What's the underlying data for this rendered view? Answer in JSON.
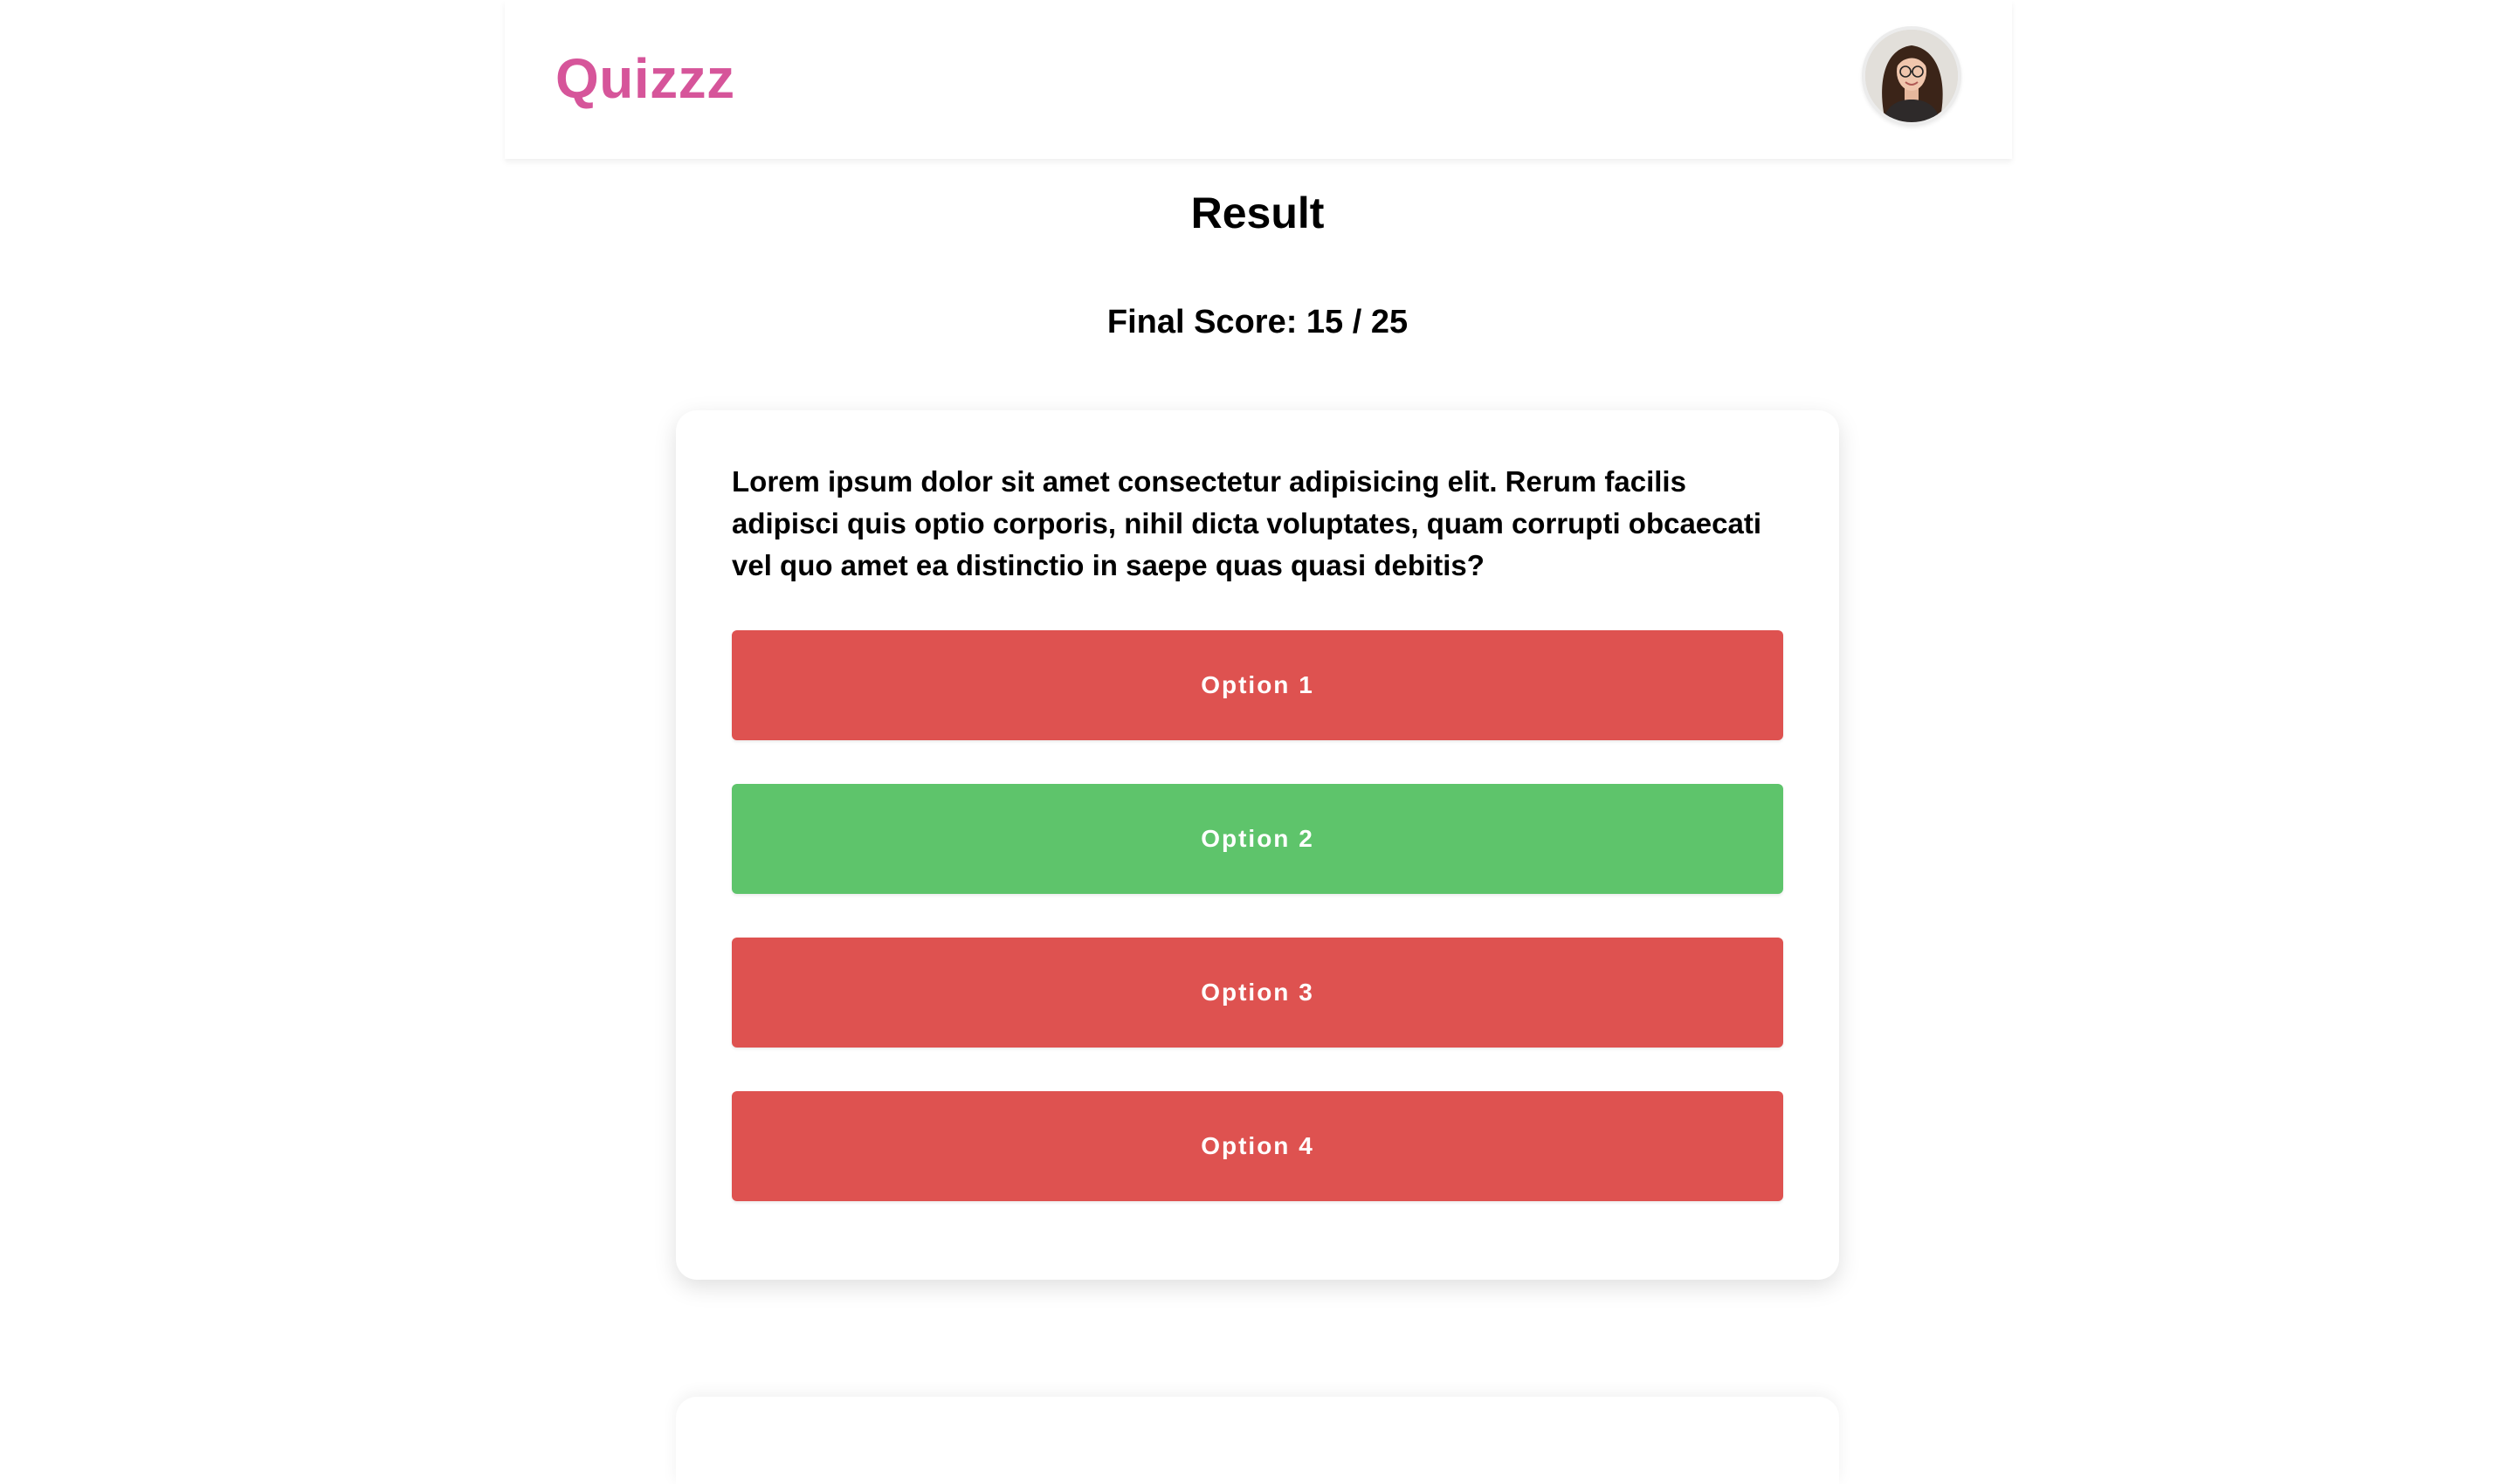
{
  "header": {
    "brand": "Quizzz",
    "brand_color": "#d6559a",
    "avatar_alt": "user-avatar"
  },
  "result": {
    "title": "Result",
    "final_score": "Final Score: 15 / 25"
  },
  "question_card": {
    "question": "Lorem ipsum dolor sit amet consectetur adipisicing elit. Rerum facilis adipisci quis optio corporis, nihil dicta voluptates, quam corrupti obcaecati vel quo amet ea distinctio in saepe quas quasi debitis?",
    "options": [
      {
        "label": "Option 1",
        "state": "wrong",
        "color": "#de5250"
      },
      {
        "label": "Option 2",
        "state": "correct",
        "color": "#5ec46b"
      },
      {
        "label": "Option 3",
        "state": "wrong",
        "color": "#de5250"
      },
      {
        "label": "Option 4",
        "state": "wrong",
        "color": "#de5250"
      }
    ]
  }
}
